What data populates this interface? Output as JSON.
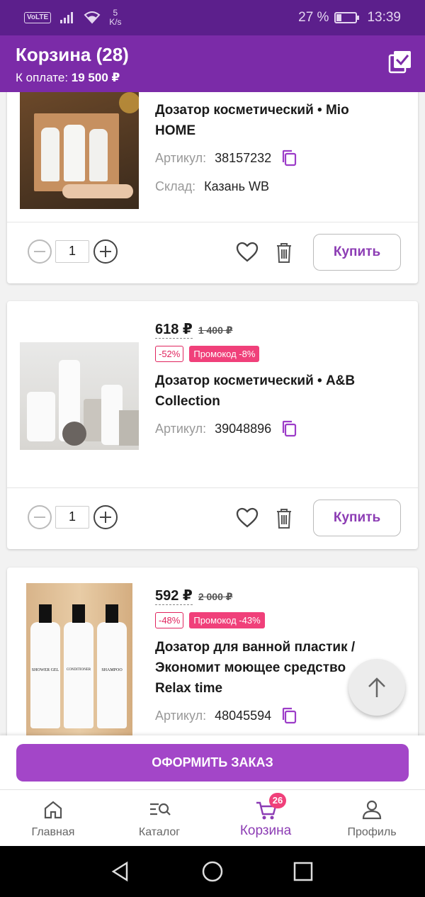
{
  "status_bar": {
    "volte": "VoLTE",
    "speed_value": "5",
    "speed_unit": "K/s",
    "battery": "27 %",
    "battery_level": 0.27,
    "time": "13:39"
  },
  "header": {
    "title": "Корзина (28)",
    "pay_label": "К оплате:",
    "pay_amount": "19 500 ₽"
  },
  "products": [
    {
      "name_line1": "Дозатор косметический • Mio",
      "name_line2": "HOME",
      "article_label": "Артикул:",
      "article": "38157232",
      "stock_label": "Склад:",
      "stock": "Казань WB",
      "quantity": "1",
      "buy_label": "Купить"
    },
    {
      "price": "618 ₽",
      "old_price": "1 400 ₽",
      "discount": "-52%",
      "promo": "Промокод -8%",
      "name_line1": "Дозатор косметический • A&B",
      "name_line2": "Collection",
      "article_label": "Артикул:",
      "article": "39048896",
      "quantity": "1",
      "buy_label": "Купить"
    },
    {
      "price": "592 ₽",
      "old_price": "2 000 ₽",
      "discount": "-48%",
      "promo": "Промокод -43%",
      "name_line1": "Дозатор для ванной пластик /",
      "name_line2": "Экономит моющее средство",
      "name_line3": "Relax time",
      "article_label": "Артикул:",
      "article": "48045594"
    }
  ],
  "image_labels": {
    "shower_gel": "SHOWER GEL",
    "conditioner": "CONDITIONER",
    "shampoo": "SHAMPOO"
  },
  "checkout_label": "ОФОРМИТЬ ЗАКАЗ",
  "nav": {
    "home": "Главная",
    "catalog": "Каталог",
    "cart": "Корзина",
    "cart_badge": "26",
    "profile": "Профиль"
  },
  "colors": {
    "header": "#7b2ba8",
    "status_bar": "#5c1f8c",
    "accent": "#a346c8",
    "promo": "#f0407a"
  }
}
